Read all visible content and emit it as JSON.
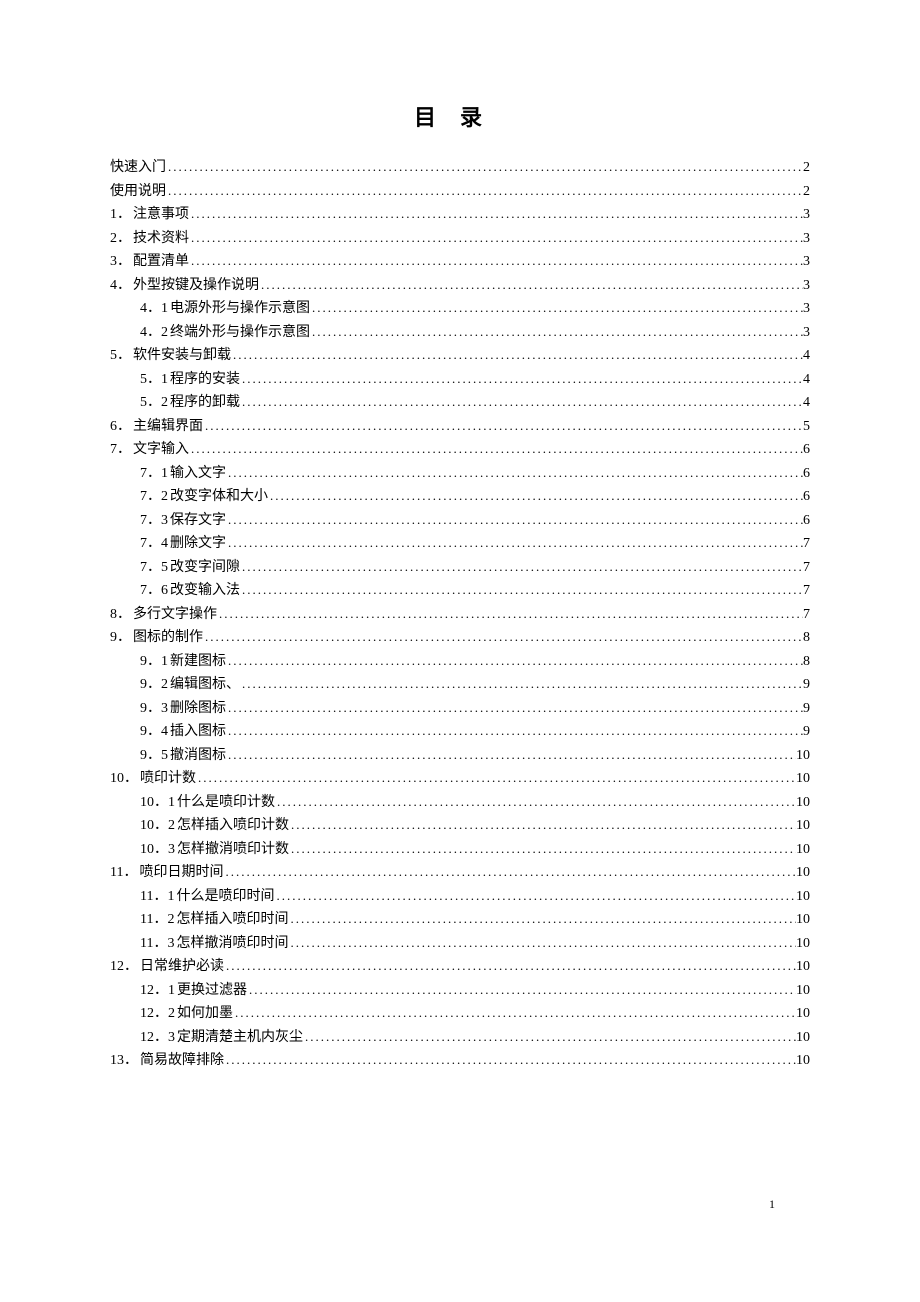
{
  "title": "目录",
  "page_number": "1",
  "toc": [
    {
      "level": 0,
      "num": "",
      "label": "快速入门",
      "page": "2"
    },
    {
      "level": 0,
      "num": "",
      "label": "使用说明",
      "page": "2"
    },
    {
      "level": 0,
      "num": "1．",
      "label": "注意事项",
      "page": "3"
    },
    {
      "level": 0,
      "num": "2．",
      "label": "技术资料",
      "page": "3"
    },
    {
      "level": 0,
      "num": "3．",
      "label": "配置清单",
      "page": "3"
    },
    {
      "level": 0,
      "num": "4．",
      "label": "外型按键及操作说明 ",
      "page": "3"
    },
    {
      "level": 1,
      "num": "4．1 ",
      "label": "电源外形与操作示意图",
      "page": "3"
    },
    {
      "level": 1,
      "num": "4．2 ",
      "label": "终端外形与操作示意图",
      "page": "3"
    },
    {
      "level": 0,
      "num": "5．",
      "label": "软件安装与卸载 ",
      "page": "4"
    },
    {
      "level": 1,
      "num": "5．1 ",
      "label": "程序的安装",
      "page": "4"
    },
    {
      "level": 1,
      "num": "5．2 ",
      "label": "程序的卸载",
      "page": "4"
    },
    {
      "level": 0,
      "num": "6．",
      "label": "主编辑界面",
      "page": "5"
    },
    {
      "level": 0,
      "num": "7．",
      "label": "文字输入",
      "page": "6"
    },
    {
      "level": 1,
      "num": "7．1 ",
      "label": "输入文字",
      "page": "6"
    },
    {
      "level": 1,
      "num": "7．2 ",
      "label": "改变字体和大小",
      "page": "6"
    },
    {
      "level": 1,
      "num": "7．3 ",
      "label": "保存文字",
      "page": "6"
    },
    {
      "level": 1,
      "num": "7．4 ",
      "label": "删除文字",
      "page": "7"
    },
    {
      "level": 1,
      "num": "7．5 ",
      "label": "改变字间隙",
      "page": "7"
    },
    {
      "level": 1,
      "num": "7．6 ",
      "label": "改变输入法",
      "page": "7"
    },
    {
      "level": 0,
      "num": "8．",
      "label": "多行文字操作",
      "page": "7"
    },
    {
      "level": 0,
      "num": "9．",
      "label": "图标的制作",
      "page": "8"
    },
    {
      "level": 1,
      "num": "9．1 ",
      "label": "新建图标",
      "page": "8"
    },
    {
      "level": 1,
      "num": "9．2 ",
      "label": "编辑图标、",
      "page": "9"
    },
    {
      "level": 1,
      "num": "9．3 ",
      "label": "删除图标",
      "page": "9"
    },
    {
      "level": 1,
      "num": "9．4 ",
      "label": "插入图标",
      "page": "9"
    },
    {
      "level": 1,
      "num": "9．5 ",
      "label": "撤消图标",
      "page": "10"
    },
    {
      "level": 0,
      "num": "10．",
      "label": "喷印计数",
      "page": "10"
    },
    {
      "level": 1,
      "num": "10．1 ",
      "label": "什么是喷印计数",
      "page": "10"
    },
    {
      "level": 1,
      "num": "10．2 ",
      "label": "怎样插入喷印计数",
      "page": "10"
    },
    {
      "level": 1,
      "num": "10．3 ",
      "label": "怎样撤消喷印计数",
      "page": "10"
    },
    {
      "level": 0,
      "num": "11．",
      "label": "喷印日期时间 ",
      "page": "10"
    },
    {
      "level": 1,
      "num": "11．1 ",
      "label": "什么是喷印时间",
      "page": "10"
    },
    {
      "level": 1,
      "num": "11．2 ",
      "label": "怎样插入喷印时间",
      "page": "10"
    },
    {
      "level": 1,
      "num": "11．3 ",
      "label": "怎样撤消喷印时间",
      "page": "10"
    },
    {
      "level": 0,
      "num": "12．",
      "label": "日常维护必读 ",
      "page": "10"
    },
    {
      "level": 1,
      "num": "12．1 ",
      "label": "更换过滤器",
      "page": "10"
    },
    {
      "level": 1,
      "num": "12．2 ",
      "label": "如何加墨",
      "page": "10"
    },
    {
      "level": 1,
      "num": "12．3 ",
      "label": "定期清楚主机内灰尘",
      "page": "10"
    },
    {
      "level": 0,
      "num": "13．",
      "label": "简易故障排除 ",
      "page": "10"
    }
  ]
}
